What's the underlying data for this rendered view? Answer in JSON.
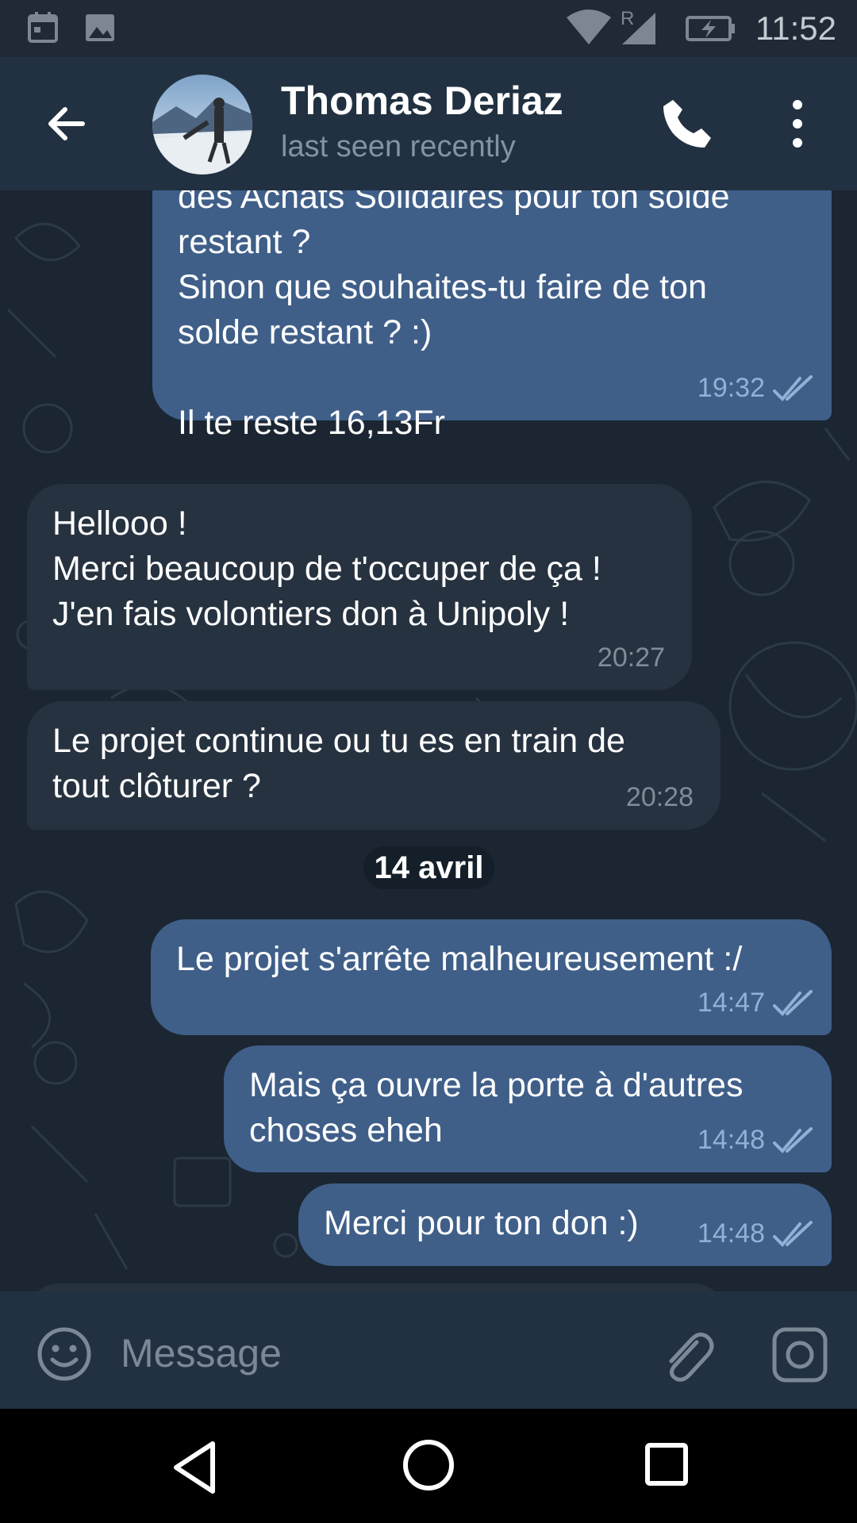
{
  "status_bar": {
    "time": "11:52",
    "network_indicator": "R"
  },
  "header": {
    "contact_name": "Thomas Deriaz",
    "status": "last seen recently"
  },
  "messages": [
    {
      "direction": "out",
      "text": "des Achats Solidaires pour ton solde\nrestant ?\nSinon que souhaites-tu faire de ton\nsolde restant ? :)\n\nIl te reste 16,13Fr",
      "time": "19:32"
    },
    {
      "direction": "in",
      "text": "Hellooo !\nMerci beaucoup de t'occuper de ça !\nJ'en fais volontiers don à Unipoly !",
      "time": "20:27"
    },
    {
      "direction": "in",
      "text": "Le projet continue ou tu es en train de\ntout clôturer ?",
      "time": "20:28"
    },
    {
      "direction": "out",
      "text": "Le projet s'arrête malheureusement :/",
      "time": "14:47"
    },
    {
      "direction": "out",
      "text": "Mais ça ouvre la porte à d'autres\nchoses eheh",
      "time": "14:48"
    },
    {
      "direction": "out",
      "text": "Merci pour ton don :)",
      "time": "14:48"
    }
  ],
  "date_separator": "14 avril",
  "input": {
    "placeholder": "Message"
  },
  "icons": [
    "back-arrow-icon",
    "phone-icon",
    "more-vert-icon",
    "emoji-icon",
    "attach-icon",
    "camera-icon",
    "double-check-icon"
  ],
  "colors": {
    "header": "#223141",
    "outgoing_bubble": "#3f5f89",
    "incoming_bubble": "#26323f",
    "background": "#1b2632",
    "check": "#8fb2d6"
  }
}
